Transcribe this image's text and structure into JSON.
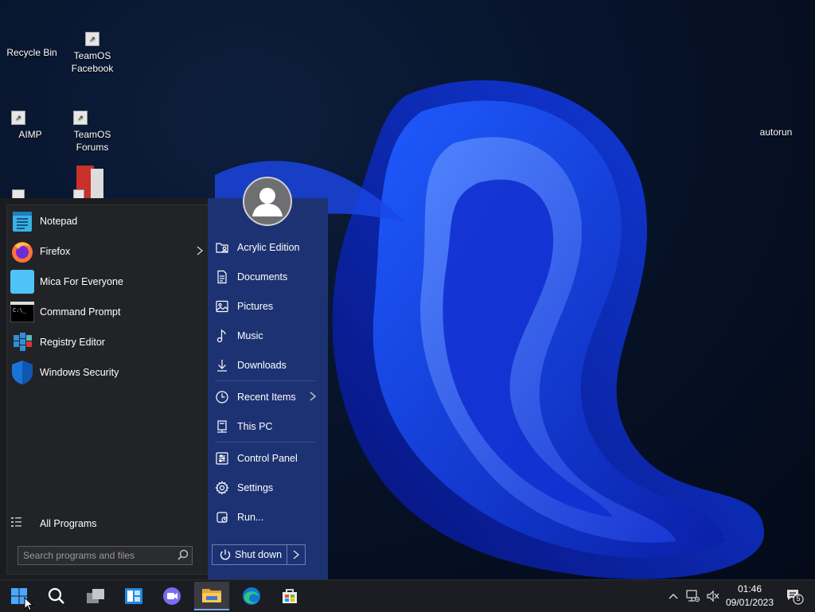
{
  "desktop": {
    "icons": [
      {
        "label": "Recycle Bin"
      },
      {
        "label": "TeamOS Facebook"
      },
      {
        "label": "AIMP"
      },
      {
        "label": "TeamOS Forums"
      },
      {
        "label": "autorun"
      }
    ]
  },
  "start_menu": {
    "programs": [
      {
        "label": "Notepad",
        "icon": "notepad-icon"
      },
      {
        "label": "Firefox",
        "icon": "firefox-icon",
        "has_submenu": true
      },
      {
        "label": "Mica For Everyone",
        "icon": "mica-icon"
      },
      {
        "label": "Command Prompt",
        "icon": "command-prompt-icon"
      },
      {
        "label": "Registry Editor",
        "icon": "registry-editor-icon"
      },
      {
        "label": "Windows Security",
        "icon": "shield-icon"
      }
    ],
    "all_programs": "All Programs",
    "search_placeholder": "Search programs and files",
    "right_links": [
      {
        "label": "Acrylic Edition",
        "icon": "user-folder-icon"
      },
      {
        "label": "Documents",
        "icon": "document-icon"
      },
      {
        "label": "Pictures",
        "icon": "picture-icon"
      },
      {
        "label": "Music",
        "icon": "music-note-icon"
      },
      {
        "label": "Downloads",
        "icon": "download-icon"
      },
      {
        "label": "Recent Items",
        "icon": "clock-icon",
        "has_submenu": true
      },
      {
        "label": "This PC",
        "icon": "computer-icon"
      },
      {
        "label": "Control Panel",
        "icon": "control-panel-icon"
      },
      {
        "label": "Settings",
        "icon": "gear-icon"
      },
      {
        "label": "Run...",
        "icon": "run-icon"
      }
    ],
    "shutdown_label": "Shut down"
  },
  "taskbar": {
    "items": [
      "start-button",
      "search-icon",
      "task-view-icon",
      "widgets-icon",
      "chat-icon",
      "file-explorer-icon",
      "edge-icon",
      "store-icon"
    ],
    "active_item": "file-explorer-icon",
    "clock_time": "01:46",
    "clock_date": "09/01/2023",
    "notification_count": "5"
  },
  "colors": {
    "start_left_bg": "#222326",
    "start_right_bg": "#1d3272",
    "taskbar_bg": "#1c1d22",
    "accent": "#0078d4"
  }
}
